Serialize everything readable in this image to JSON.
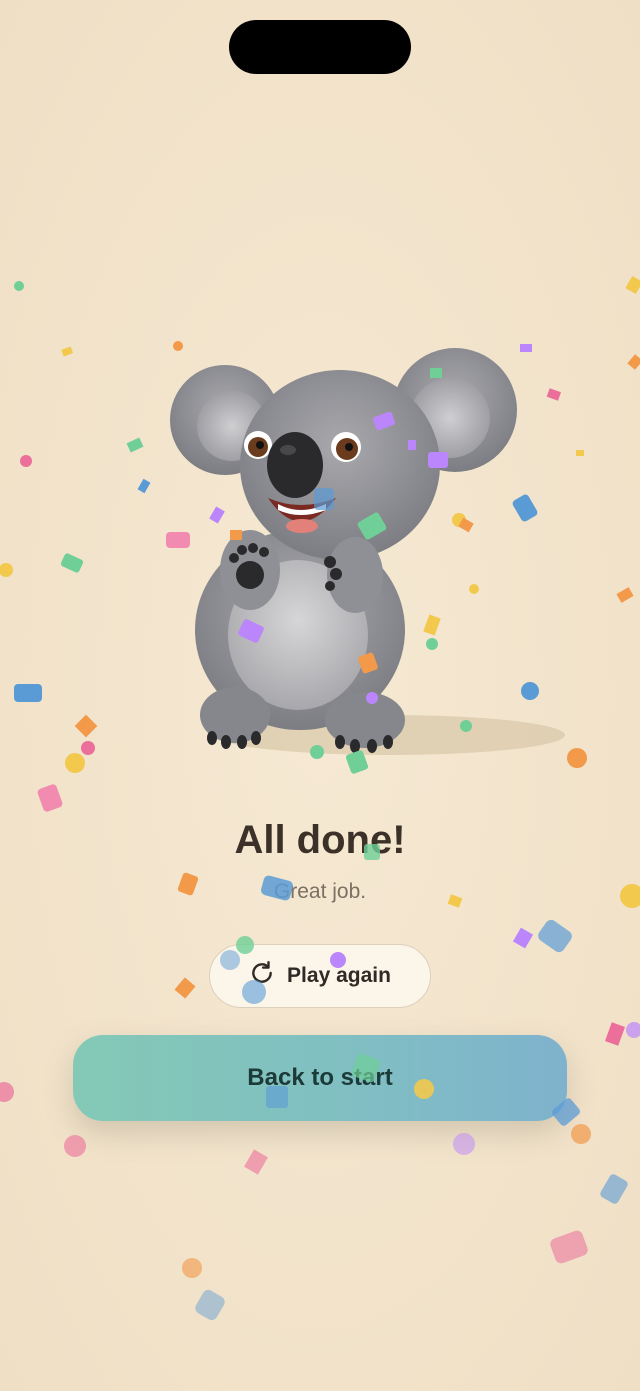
{
  "completion": {
    "title": "All done!",
    "subtitle": "Great job."
  },
  "actions": {
    "play_again_label": "Play again",
    "back_to_start_label": "Back to start"
  },
  "icons": {
    "mascot": "koala-illustration",
    "replay": "refresh-icon"
  },
  "colors": {
    "background": "#f2e4cc",
    "title": "#3b3128",
    "primary_gradient_start": "#84c9b6",
    "primary_gradient_end": "#7fb2cd"
  }
}
